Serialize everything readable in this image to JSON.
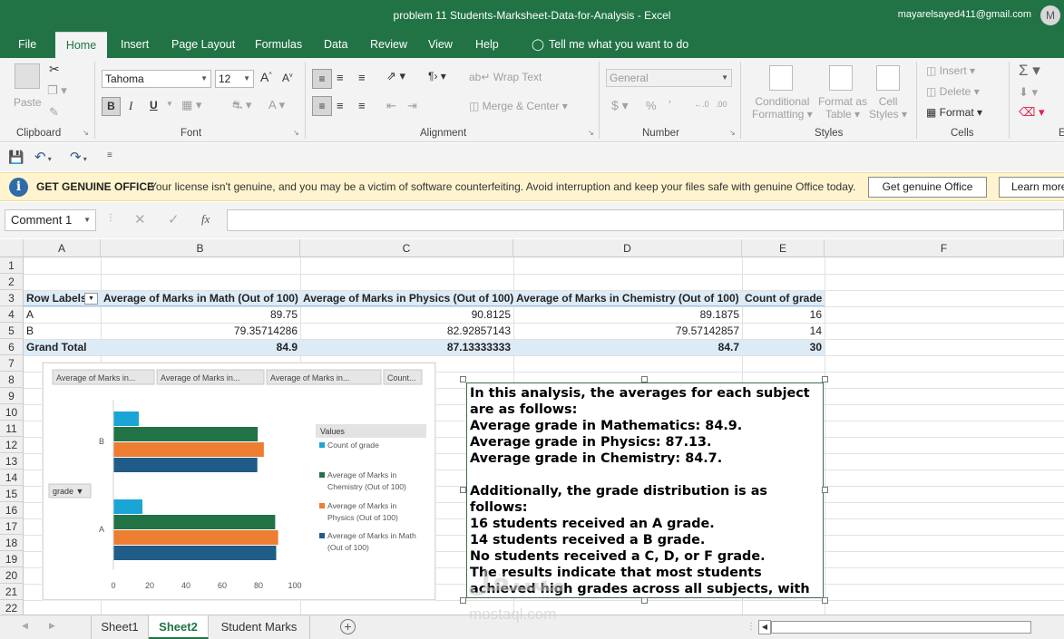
{
  "window": {
    "title": "problem 11 Students-Marksheet-Data-for-Analysis  -  Excel",
    "account": "mayarelsayed411@gmail.com",
    "avatar_letter": "M"
  },
  "ribbon_tabs": [
    "File",
    "Home",
    "Insert",
    "Page Layout",
    "Formulas",
    "Data",
    "Review",
    "View",
    "Help"
  ],
  "tell_me": "Tell me what you want to do",
  "ribbon": {
    "clipboard": {
      "paste": "Paste",
      "label": "Clipboard"
    },
    "font": {
      "name": "Tahoma",
      "size": "12",
      "bold": "B",
      "italic": "I",
      "underline": "U",
      "label": "Font"
    },
    "alignment": {
      "wrap": "Wrap Text",
      "merge": "Merge & Center",
      "label": "Alignment"
    },
    "number": {
      "format": "General",
      "label": "Number"
    },
    "styles": {
      "conditional": "Conditional",
      "conditional2": "Formatting",
      "format_as": "Format as",
      "table": "Table",
      "cell": "Cell",
      "styles": "Styles",
      "label": "Styles"
    },
    "cells": {
      "insert": "Insert",
      "delete": "Delete",
      "format": "Format",
      "label": "Cells"
    },
    "editing_label": "E"
  },
  "banner": {
    "title": "GET GENUINE OFFICE",
    "message": "Your license isn't genuine, and you may be a victim of software counterfeiting. Avoid interruption and keep your files safe with genuine Office today.",
    "button1": "Get genuine Office",
    "button2": "Learn more"
  },
  "formula_bar": {
    "name_box": "Comment 1",
    "fx": "fx",
    "value": ""
  },
  "columns": [
    "A",
    "B",
    "C",
    "D",
    "E",
    "F"
  ],
  "rows": [
    "1",
    "2",
    "3",
    "4",
    "5",
    "6",
    "7",
    "8",
    "9",
    "10",
    "11",
    "12",
    "13",
    "14",
    "15",
    "16",
    "17",
    "18",
    "19",
    "20",
    "21",
    "22"
  ],
  "pivot": {
    "headers": [
      "Row Labels",
      "Average of Marks in Math (Out of 100)",
      "Average of Marks in Physics (Out of 100)",
      "Average of Marks in Chemistry (Out of 100)",
      "Count of grade"
    ],
    "rows": [
      [
        "A",
        "89.75",
        "90.8125",
        "89.1875",
        "16"
      ],
      [
        "B",
        "79.35714286",
        "82.92857143",
        "79.57142857",
        "14"
      ]
    ],
    "total": [
      "Grand Total",
      "84.9",
      "87.13333333",
      "84.7",
      "30"
    ]
  },
  "chart_data": {
    "type": "bar",
    "orientation": "horizontal",
    "field_buttons": [
      "Average of Marks in...",
      "Average of Marks in...",
      "Average of Marks in...",
      "Count..."
    ],
    "axis_field_button": "grade",
    "categories": [
      "A",
      "B"
    ],
    "series": [
      {
        "name": "Count of grade",
        "values": [
          16,
          14
        ],
        "color": "#1aa5d6"
      },
      {
        "name": "Average of Marks in Chemistry (Out of 100)",
        "values": [
          89.1875,
          79.57142857
        ],
        "color": "#217346"
      },
      {
        "name": "Average of Marks in Physics (Out of 100)",
        "values": [
          90.8125,
          82.92857143
        ],
        "color": "#ed7d31"
      },
      {
        "name": "Average of Marks in Math (Out of 100)",
        "values": [
          89.75,
          79.35714286
        ],
        "color": "#1f5c87"
      }
    ],
    "legend_title": "Values",
    "legend_position": "right",
    "xlim": [
      0,
      100
    ],
    "xticks": [
      "0",
      "20",
      "40",
      "60",
      "80",
      "100"
    ],
    "grid": false
  },
  "textbox": {
    "text": "In this analysis, the averages for each subject are as follows:\nAverage grade in Mathematics: 84.9.\nAverage grade in Physics: 87.13.\nAverage grade in Chemistry: 84.7.\n\nAdditionally, the grade distribution is as follows:\n16 students received an A grade.\n14 students received a B grade.\nNo students received a C, D, or F grade.\nThe results indicate that most students achieved high grades across all subjects, with a noticeable excellence in Physics."
  },
  "watermark": {
    "arabic": "مستقل",
    "latin": "mostaql.com"
  },
  "sheets": [
    "Sheet1",
    "Sheet2",
    "Student Marks"
  ],
  "active_sheet": "Sheet2",
  "colors": {
    "excel_green": "#217346",
    "pivot_header": "#ddebf7",
    "banner": "#fff4ce"
  }
}
